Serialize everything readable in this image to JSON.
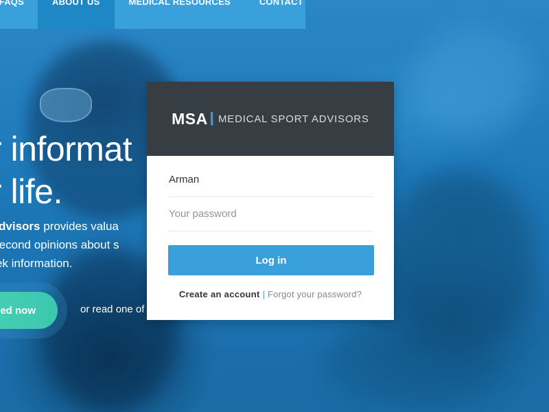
{
  "nav": {
    "items": [
      {
        "label": "FAQs"
      },
      {
        "label": "About Us"
      },
      {
        "label": "Medical Resources"
      },
      {
        "label": "Contact"
      }
    ]
  },
  "hero": {
    "headline_line1": "r informat",
    "headline_line2": "r life.",
    "intro_bold": "t Advisors",
    "intro_rest": " provides valua",
    "intro_line2": "d second opinions about s",
    "intro_line3": " seek information.",
    "cta_label": "ed now",
    "or_read": "or read one of"
  },
  "login": {
    "brand_mark": "MSA",
    "brand_name": "Medical Sport Advisors",
    "username_value": "Arman",
    "password_placeholder": "Your password",
    "login_label": "Log in",
    "create_account": "Create an account",
    "separator": "|",
    "forgot_password": "Forgot your password?"
  },
  "colors": {
    "nav_bg": "#3aa0dc",
    "nav_active": "#1e87c6",
    "card_header": "#363d43",
    "accent": "#3aa0dc",
    "cta": "#49d1b3"
  }
}
